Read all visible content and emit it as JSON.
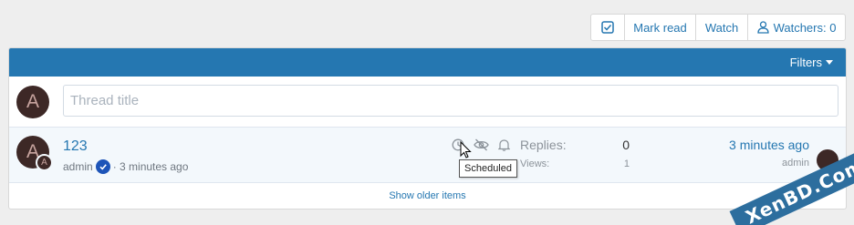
{
  "actions": {
    "mark_read": "Mark read",
    "watch": "Watch",
    "watchers": "Watchers: 0"
  },
  "panel": {
    "filters": "Filters"
  },
  "new_thread": {
    "avatar_letter": "A",
    "placeholder": "Thread title"
  },
  "thread": {
    "avatar_letter": "A",
    "mini_avatar_letter": "A",
    "title": "123",
    "author": "admin",
    "age": "· 3 minutes ago",
    "replies_label": "Replies:",
    "replies_value": "0",
    "views_label": "Views:",
    "views_value": "1",
    "last_time": "3 minutes ago",
    "last_user": "admin"
  },
  "tooltip": "Scheduled",
  "footer": {
    "show_older": "Show older items"
  },
  "watermark": "XenBD.Com",
  "colors": {
    "accent": "#2577b1",
    "verified": "#1d54b8",
    "avatar_bg": "#3d2826"
  }
}
